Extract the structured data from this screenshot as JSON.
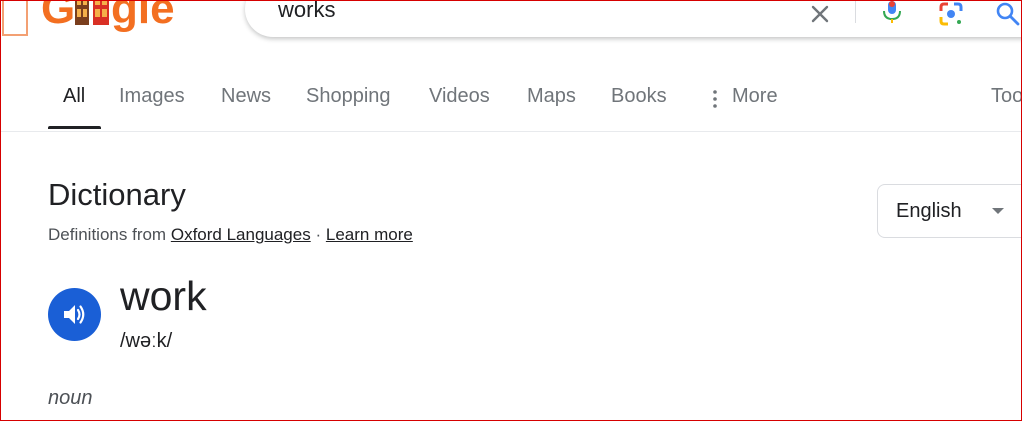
{
  "logo": {
    "text": "Google",
    "colors": {
      "orange": "#f97316",
      "red": "#d93025",
      "brown": "#7a3e1d"
    }
  },
  "search": {
    "query": "works",
    "clear_icon": "close-icon",
    "mic_icon": "mic-icon",
    "lens_icon": "google-lens-icon",
    "search_icon": "search-icon"
  },
  "tabs": [
    {
      "label": "All",
      "active": true
    },
    {
      "label": "Images"
    },
    {
      "label": "News"
    },
    {
      "label": "Shopping"
    },
    {
      "label": "Videos"
    },
    {
      "label": "Maps"
    },
    {
      "label": "Books"
    },
    {
      "label": "More",
      "icon": "more-vert-icon"
    },
    {
      "label": "Tools"
    }
  ],
  "dictionary": {
    "title": "Dictionary",
    "source_prefix": "Definitions from",
    "source_link": "Oxford Languages",
    "separator": "·",
    "learn_more": "Learn more",
    "language": "English",
    "word": "work",
    "phonetic": "/wəːk/",
    "part_of_speech": "noun",
    "speaker_icon": "speaker-icon",
    "accent_color": "#1a5fd6"
  }
}
